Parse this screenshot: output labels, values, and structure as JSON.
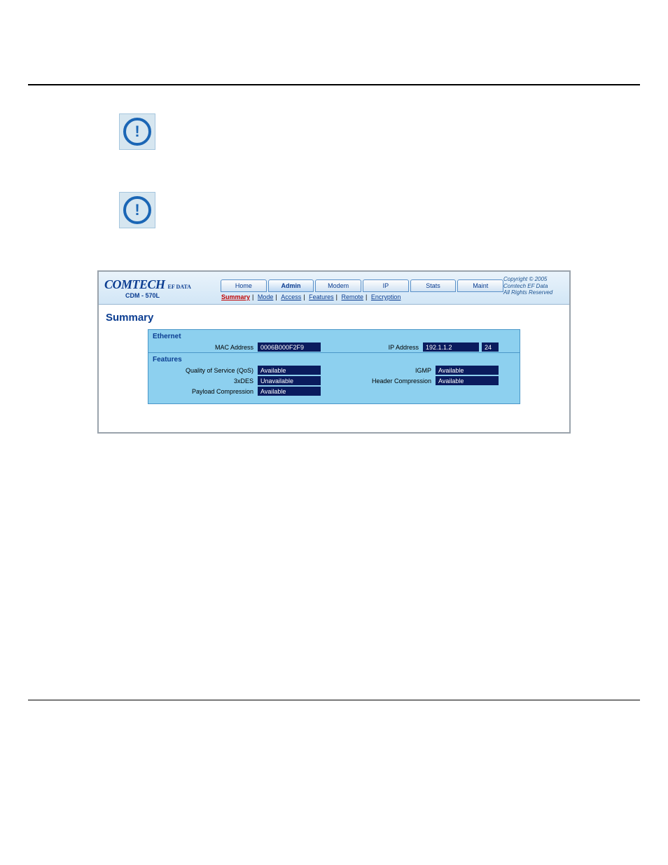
{
  "header": {
    "logo_text": "COMTECH",
    "logo_sub": "EF DATA",
    "model": "CDM - 570L",
    "tabs": [
      "Home",
      "Admin",
      "Modem",
      "IP",
      "Stats",
      "Maint"
    ],
    "active_tab_index": 1,
    "subnav": [
      "Summary",
      "Mode",
      "Access",
      "Features",
      "Remote",
      "Encryption"
    ],
    "subnav_selected_index": 0,
    "copyright1": "Copyright © 2005",
    "copyright2": "Comtech EF Data",
    "copyright3": "All Rights Reserved"
  },
  "page_title": "Summary",
  "sections": {
    "ethernet": {
      "title": "Ethernet",
      "mac_label": "MAC Address",
      "mac_value": "0006B000F2F9",
      "ip_label": "IP Address",
      "ip_value": "192.1.1.2",
      "mask_value": "24"
    },
    "features": {
      "title": "Features",
      "qos_label": "Quality of Service (QoS)",
      "qos_value": "Available",
      "des_label": "3xDES",
      "des_value": "Unavailable",
      "payload_label": "Payload Compression",
      "payload_value": "Available",
      "igmp_label": "IGMP",
      "igmp_value": "Available",
      "header_label": "Header Compression",
      "header_value": "Available"
    }
  }
}
